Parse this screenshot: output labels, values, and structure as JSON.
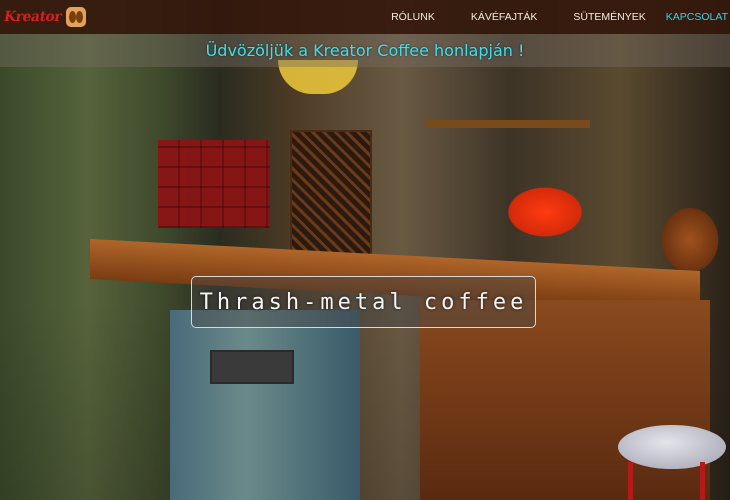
{
  "header": {
    "logo_text": "Kreator",
    "logo_icon": "coffee-bean-icon",
    "nav": [
      {
        "label": "RÓLUNK"
      },
      {
        "label": "KÁVÉFAJTÁK"
      },
      {
        "label": "SÜTEMÉNYEK"
      },
      {
        "label": "KAPCSOLAT"
      }
    ],
    "active_index": 3
  },
  "hero": {
    "welcome": "Üdvözöljük a Kreator Coffee honlapján !",
    "slogan": "Thrash-metal coffee"
  },
  "colors": {
    "nav_bg": "#34180c",
    "nav_active": "#38d1e8",
    "welcome_text": "#3fe0ee",
    "logo_red": "#d42020"
  }
}
